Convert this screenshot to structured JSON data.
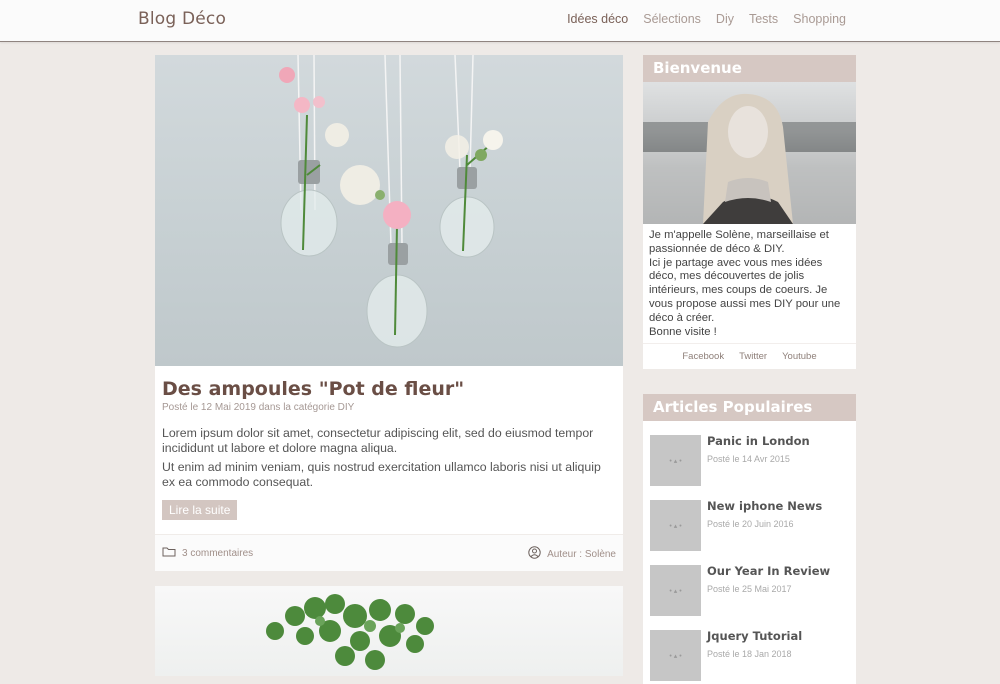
{
  "header": {
    "brand": "Blog Déco",
    "nav": [
      "Idées déco",
      "Sélections",
      "Diy",
      "Tests",
      "Shopping"
    ]
  },
  "post": {
    "title": "Des ampoules \"Pot de fleur\"",
    "meta": "Posté le 12 Mai 2019 dans la catégorie DIY",
    "body": [
      "Lorem ipsum dolor sit amet, consectetur adipiscing elit, sed do eiusmod tempor incididunt ut labore et dolore magna aliqua.",
      "Ut enim ad minim veniam, quis nostrud exercitation ullamco laboris nisi ut aliquip ex ea commodo consequat."
    ],
    "read_more": "Lire la suite",
    "comments": "3 commentaires",
    "author": "Auteur : Solène"
  },
  "sidebar": {
    "welcome": {
      "title": "Bienvenue",
      "lines": [
        "Je m'appelle Solène, marseillaise et passionnée de déco & DIY.",
        "Ici je partage avec vous mes idées déco, mes découvertes de jolis intérieurs, mes coups de coeurs. Je vous propose aussi mes DIY pour une déco à créer.",
        "Bonne visite !"
      ],
      "social": [
        "Facebook",
        "Twitter",
        "Youtube"
      ]
    },
    "popular": {
      "title": "Articles Populaires",
      "thumb_label": "• ▴ •",
      "items": [
        {
          "title": "Panic in London",
          "date": "Posté le 14 Avr 2015"
        },
        {
          "title": "New iphone News",
          "date": "Posté le 20 Juin 2016"
        },
        {
          "title": "Our Year In Review",
          "date": "Posté le 25 Mai 2017"
        },
        {
          "title": "Jquery Tutorial",
          "date": "Posté le 18 Jan 2018"
        }
      ]
    }
  },
  "colors": {
    "accent": "#d6c8c3",
    "title": "#6a4e45",
    "background": "#eeeae7"
  }
}
